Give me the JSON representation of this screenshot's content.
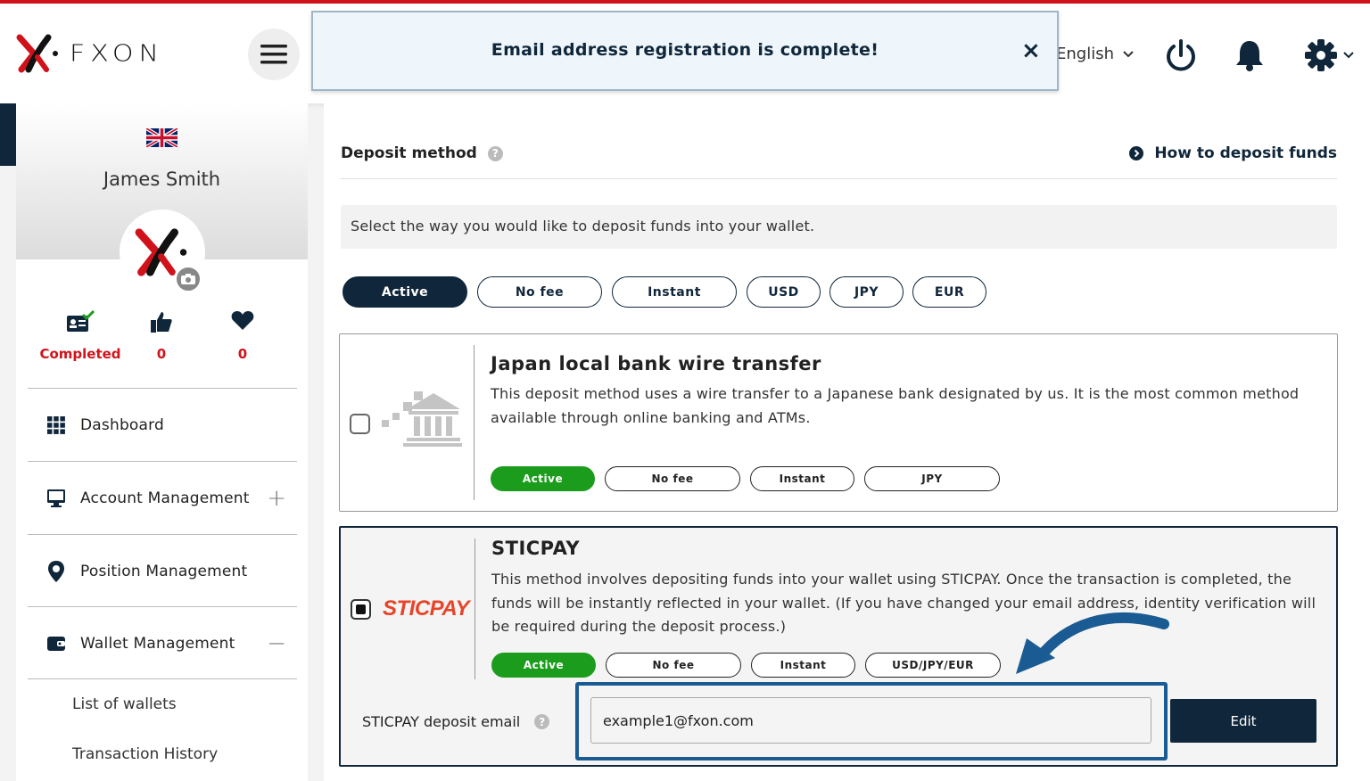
{
  "header": {
    "brand": "FXON",
    "language": "English"
  },
  "toast": {
    "message": "Email address registration is complete!",
    "close": "×"
  },
  "profile": {
    "name": "James Smith",
    "stats": [
      {
        "label": "Completed",
        "icon": "id-card-check-icon"
      },
      {
        "value": "0",
        "icon": "thumbs-up-icon"
      },
      {
        "value": "0",
        "icon": "heart-icon"
      }
    ]
  },
  "sidebar": {
    "items": [
      {
        "label": "Dashboard",
        "icon": "grid-icon"
      },
      {
        "label": "Account Management",
        "icon": "monitor-icon",
        "toggle": "+"
      },
      {
        "label": "Position Management",
        "icon": "map-pin-icon"
      },
      {
        "label": "Wallet Management",
        "icon": "wallet-icon",
        "toggle": "−"
      }
    ],
    "subitems": [
      "List of wallets",
      "Transaction History"
    ]
  },
  "main": {
    "section_title": "Deposit method",
    "help": "?",
    "how_to": "How to deposit funds",
    "hint": "Select the way you would like to deposit funds into your wallet.",
    "filters": [
      "Active",
      "No fee",
      "Instant",
      "USD",
      "JPY",
      "EUR"
    ],
    "methods": [
      {
        "title": "Japan local bank wire transfer",
        "description": "This deposit method uses a wire transfer to a Japanese bank designated by us. It is the most common method available through online banking and ATMs.",
        "tags": [
          "Active",
          "No fee",
          "Instant",
          "JPY"
        ],
        "selected": false
      },
      {
        "title": "STICPAY",
        "logo_text": "STICPAY",
        "description": "This method involves depositing funds into your wallet using STICPAY. Once the transaction is completed, the funds will be instantly reflected in your wallet. (If you have changed your email address, identity verification will be required during the deposit process.)",
        "tags": [
          "Active",
          "No fee",
          "Instant",
          "USD/JPY/EUR"
        ],
        "selected": true,
        "email_label": "STICPAY deposit email",
        "email_value": "example1@fxon.com",
        "edit_label": "Edit"
      }
    ]
  },
  "colors": {
    "brand_red": "#d0121b",
    "navy": "#10263a",
    "active_green": "#1c9c1c",
    "highlight_blue": "#1a5b93",
    "sticpay_orange": "#e6452a"
  }
}
